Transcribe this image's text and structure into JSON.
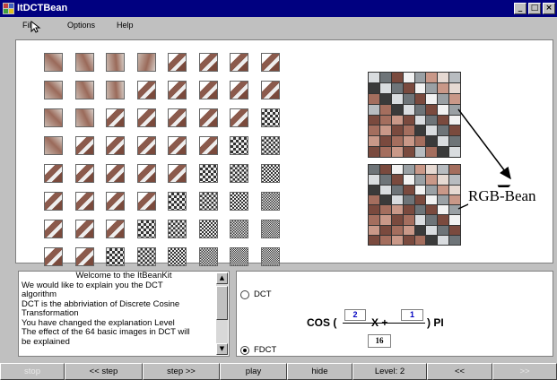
{
  "window": {
    "title": "ItDCTBean"
  },
  "titlebar_buttons": [
    "_",
    "□",
    "×"
  ],
  "menu": [
    {
      "label": "File"
    },
    {
      "label": "Options"
    },
    {
      "label": "Help"
    }
  ],
  "callout": {
    "label": "RGB-Bean"
  },
  "explanation": {
    "heading": "Welcome to the ItBeanKit",
    "lines": [
      "We would like to explain you the DCT",
      "algorithm",
      "DCT is the abbriviation of Discrete Cosine",
      "Transformation",
      "You have changed the explanation Level",
      "The effect of the 64 basic images in DCT will",
      "be explained"
    ]
  },
  "scroll": {
    "up_arrow": "▲",
    "down_arrow": "▼"
  },
  "transform": {
    "options": [
      {
        "label": "DCT",
        "selected": false
      },
      {
        "label": "FDCT",
        "selected": true
      }
    ],
    "cos_label": "COS (",
    "x_label": "X +",
    "pi_label": ") PI",
    "numerator_a": "2",
    "numerator_b": "1",
    "denominator": "16"
  },
  "buttons": [
    {
      "label": "stop",
      "enabled": false
    },
    {
      "label": "<< step",
      "enabled": true
    },
    {
      "label": "step >>",
      "enabled": true
    },
    {
      "label": "play",
      "enabled": true
    },
    {
      "label": "hide",
      "enabled": true
    },
    {
      "label": "Level: 2",
      "enabled": true
    },
    {
      "label": "<<",
      "enabled": true
    },
    {
      "label": ">>",
      "enabled": false
    }
  ],
  "colors": {
    "titlebar": "#000080",
    "face": "#c0c0c0",
    "arrow": "#000000"
  }
}
